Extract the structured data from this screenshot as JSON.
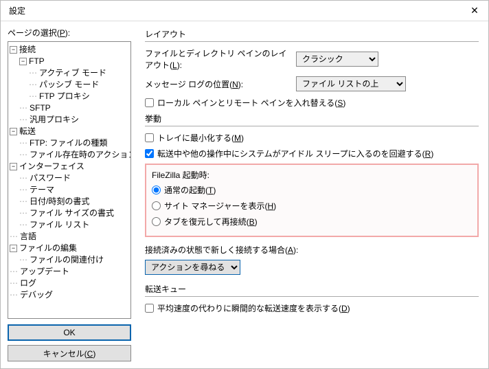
{
  "window": {
    "title": "設定",
    "close": "✕"
  },
  "left": {
    "label_pre": "ページの選択(",
    "label_u": "P",
    "label_post": "):",
    "tree": {
      "n0": "接続",
      "n0_0": "FTP",
      "n0_0_0": "アクティブ モード",
      "n0_0_1": "パッシブ モード",
      "n0_0_2": "FTP プロキシ",
      "n0_1": "SFTP",
      "n0_2": "汎用プロキシ",
      "n1": "転送",
      "n1_0": "FTP: ファイルの種類",
      "n1_1": "ファイル存在時のアクション",
      "n2": "インターフェイス",
      "n2_0": "パスワード",
      "n2_1": "テーマ",
      "n2_2": "日付/時刻の書式",
      "n2_3": "ファイル サイズの書式",
      "n2_4": "ファイル リスト",
      "n3": "言語",
      "n4": "ファイルの編集",
      "n4_0": "ファイルの関連付け",
      "n5": "アップデート",
      "n6": "ログ",
      "n7": "デバッグ"
    },
    "ok": "OK",
    "cancel_pre": "キャンセル(",
    "cancel_u": "C",
    "cancel_post": ")"
  },
  "right": {
    "sec_layout": "レイアウト",
    "row_layout_pre": "ファイルとディレクトリ ペインのレイアウト(",
    "row_layout_u": "L",
    "row_layout_post": "):",
    "sel_layout": "クラシック",
    "row_msgpos_pre": "メッセージ ログの位置(",
    "row_msgpos_u": "N",
    "row_msgpos_post": "):",
    "sel_msgpos": "ファイル リストの上",
    "chk_swap_pre": "ローカル ペインとリモート ペインを入れ替える(",
    "chk_swap_u": "S",
    "chk_swap_post": ")",
    "sec_behav": "挙動",
    "chk_tray_pre": "トレイに最小化する(",
    "chk_tray_u": "M",
    "chk_tray_post": ")",
    "chk_idle_pre": "転送中や他の操作中にシステムがアイドル スリープに入るのを回避する(",
    "chk_idle_u": "R",
    "chk_idle_post": ")",
    "startup_head": "FileZilla 起動時:",
    "rad_normal_pre": "通常の起動(",
    "rad_normal_u": "T",
    "rad_normal_post": ")",
    "rad_site_pre": "サイト マネージャーを表示(",
    "rad_site_u": "H",
    "rad_site_post": ")",
    "rad_tab_pre": "タブを復元して再接続(",
    "rad_tab_u": "B",
    "rad_tab_post": ")",
    "row_already_pre": "接続済みの状態で新しく接続する場合(",
    "row_already_u": "A",
    "row_already_post": "):",
    "sel_already": "アクションを尋ねる",
    "sec_queue": "転送キュー",
    "chk_speed_pre": "平均速度の代わりに瞬間的な転送速度を表示する(",
    "chk_speed_u": "D",
    "chk_speed_post": ")"
  }
}
